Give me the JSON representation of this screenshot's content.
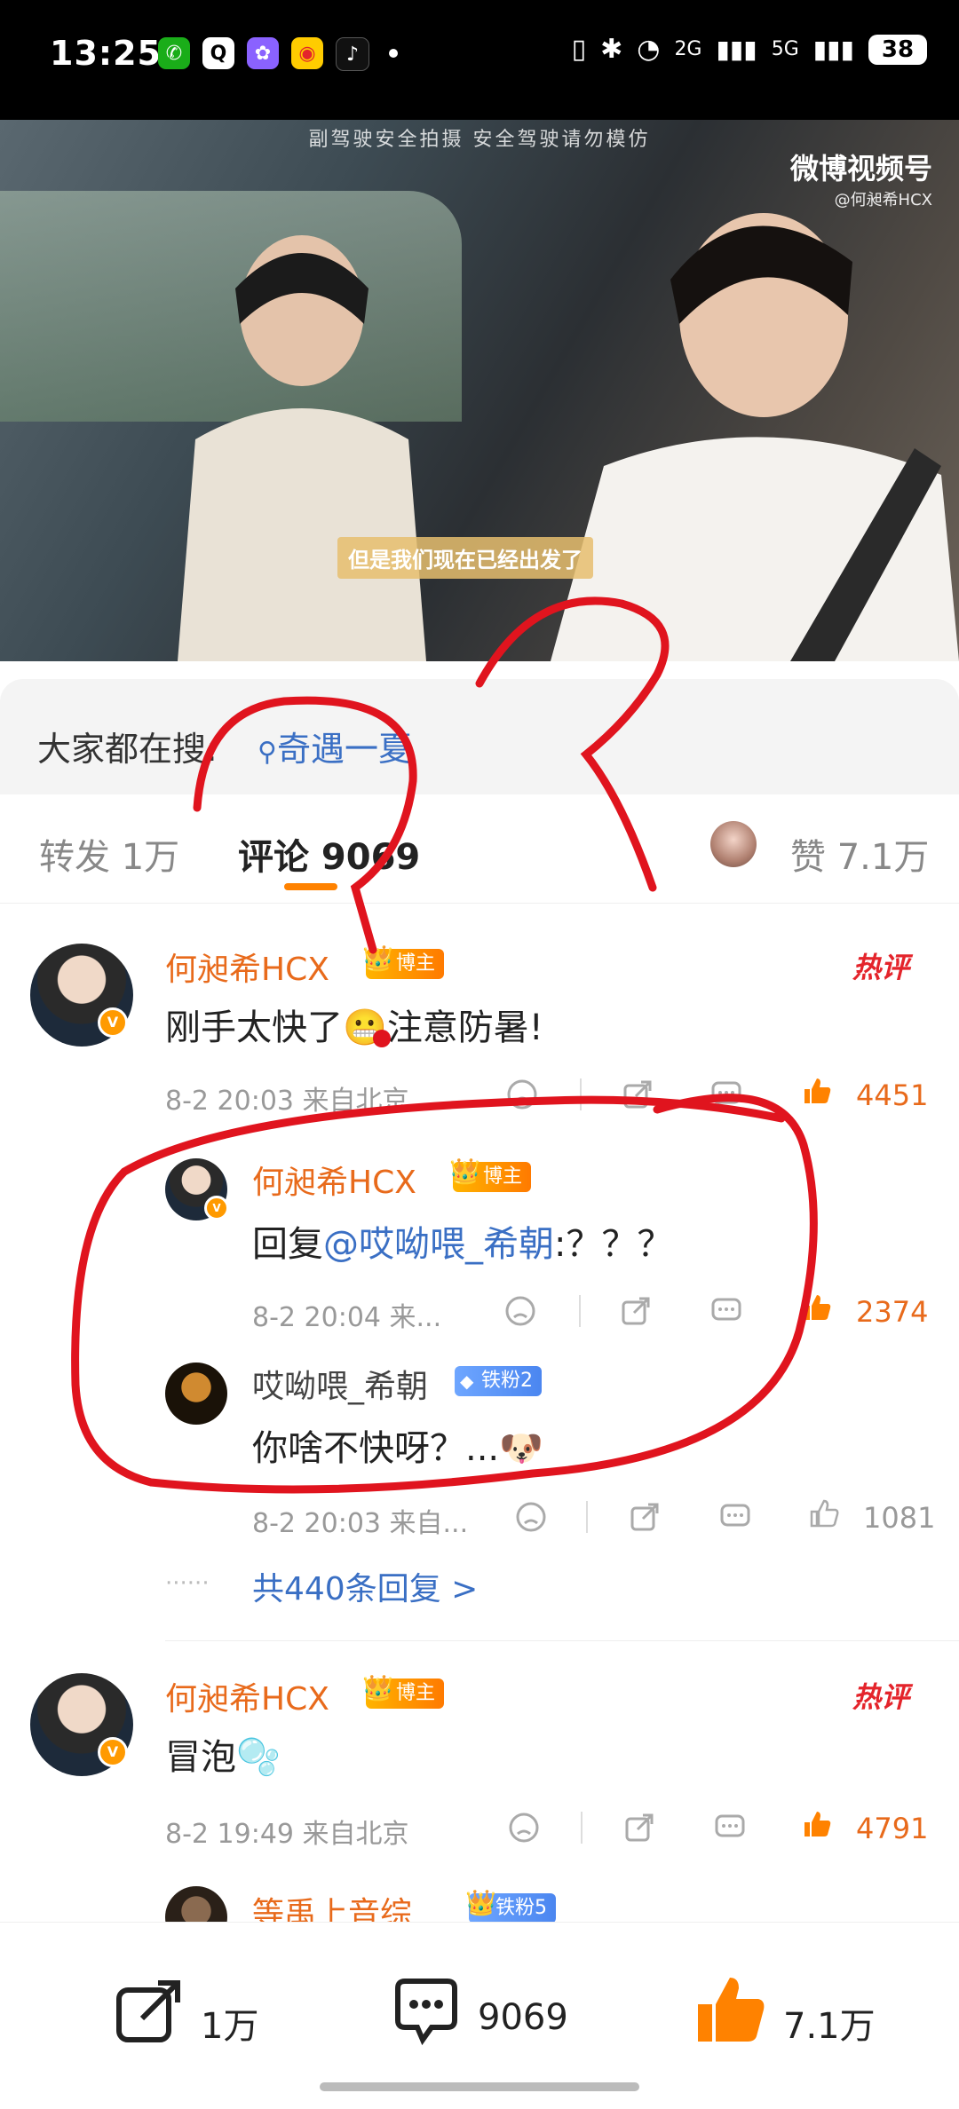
{
  "status_bar": {
    "time": "13:25",
    "network_left": "2G",
    "network_right": "5G",
    "battery": "38"
  },
  "video": {
    "top_caption": "副驾驶安全拍摄 安全驾驶请勿模仿",
    "watermark_title": "微博视频号",
    "watermark_user": "@何昶希HCX",
    "subtitle": "但是我们现在已经出发了"
  },
  "search_hint": {
    "label": "大家都在搜:",
    "query": "奇遇一夏"
  },
  "tabs": {
    "repost": "转发 1万",
    "comments": "评论 9069",
    "likes": "赞 7.1万"
  },
  "comments": [
    {
      "user": "何昶希HCX",
      "badge": "博主",
      "hot": "热评",
      "text_a": "刚手太快了",
      "emoji": "😬",
      "text_b": "注意防暑!",
      "meta": "8-2 20:03 来自北京",
      "likes": "4451",
      "replies": [
        {
          "user": "何昶希HCX",
          "badge": "博主",
          "prefix": "回复",
          "mention": "@哎呦喂_希朝",
          "suffix": ":？？？",
          "meta": "8-2 20:04 来...",
          "likes": "2374"
        },
        {
          "user": "哎呦喂_希朝",
          "badge": "铁粉2",
          "text": "你啥不快呀？...",
          "emoji": "🐶",
          "meta": "8-2 20:03 来自...",
          "likes": "1081"
        }
      ],
      "more_replies": "共440条回复 >"
    },
    {
      "user": "何昶希HCX",
      "badge": "博主",
      "hot": "热评",
      "text": "冒泡",
      "emoji": "🫧",
      "meta": "8-2 19:49 来自北京",
      "likes": "4791"
    },
    {
      "user": "等禹上音综",
      "badge": "铁粉5"
    }
  ],
  "bottom_bar": {
    "repost": "1万",
    "comments": "9069",
    "likes": "7.1万"
  },
  "colors": {
    "accent": "#ff8200",
    "name_orange": "#e86a1b",
    "link_blue": "#3a6fc4",
    "annotation_red": "#e0141e"
  },
  "icons": [
    "wechat-icon",
    "qq-icon",
    "app-icon",
    "weibo-icon",
    "tiktok-icon",
    "vibrate-icon",
    "bluetooth-icon",
    "wifi-icon",
    "signal-icon",
    "battery-icon",
    "search-icon",
    "share-icon",
    "comment-icon",
    "like-icon",
    "dislike-icon"
  ]
}
